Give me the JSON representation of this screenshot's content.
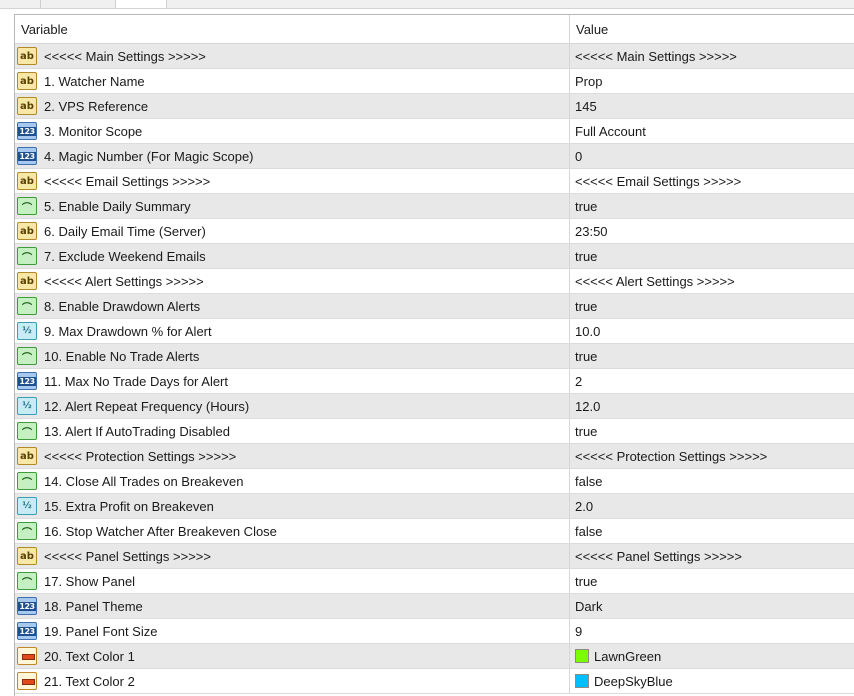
{
  "columns": {
    "variable": "Variable",
    "value": "Value"
  },
  "rows": [
    {
      "type": "string",
      "icon": "string-type-icon",
      "label": "<<<<< Main Settings >>>>>",
      "value": "<<<<< Main Settings >>>>>"
    },
    {
      "type": "string",
      "icon": "string-type-icon",
      "label": "1. Watcher Name",
      "value": "Prop"
    },
    {
      "type": "string",
      "icon": "string-type-icon",
      "label": "2. VPS Reference",
      "value": "145"
    },
    {
      "type": "integer",
      "icon": "integer-type-icon",
      "label": "3. Monitor Scope",
      "value": "Full Account"
    },
    {
      "type": "integer",
      "icon": "integer-type-icon",
      "label": "4. Magic Number (For Magic Scope)",
      "value": "0"
    },
    {
      "type": "string",
      "icon": "string-type-icon",
      "label": "<<<<< Email Settings >>>>>",
      "value": "<<<<< Email Settings >>>>>"
    },
    {
      "type": "bool",
      "icon": "bool-type-icon",
      "label": "5. Enable Daily Summary",
      "value": "true"
    },
    {
      "type": "string",
      "icon": "string-type-icon",
      "label": "6. Daily Email Time (Server)",
      "value": "23:50"
    },
    {
      "type": "bool",
      "icon": "bool-type-icon",
      "label": "7. Exclude Weekend Emails",
      "value": "true"
    },
    {
      "type": "string",
      "icon": "string-type-icon",
      "label": "<<<<< Alert Settings >>>>>",
      "value": "<<<<< Alert Settings >>>>>"
    },
    {
      "type": "bool",
      "icon": "bool-type-icon",
      "label": "8. Enable Drawdown Alerts",
      "value": "true"
    },
    {
      "type": "double",
      "icon": "double-type-icon",
      "label": "9. Max Drawdown % for Alert",
      "value": "10.0"
    },
    {
      "type": "bool",
      "icon": "bool-type-icon",
      "label": "10. Enable No Trade Alerts",
      "value": "true"
    },
    {
      "type": "integer",
      "icon": "integer-type-icon",
      "label": "11. Max No Trade Days for Alert",
      "value": "2"
    },
    {
      "type": "double",
      "icon": "double-type-icon",
      "label": "12. Alert Repeat Frequency (Hours)",
      "value": "12.0"
    },
    {
      "type": "bool",
      "icon": "bool-type-icon",
      "label": "13. Alert If AutoTrading Disabled",
      "value": "true"
    },
    {
      "type": "string",
      "icon": "string-type-icon",
      "label": "<<<<< Protection Settings >>>>>",
      "value": "<<<<< Protection Settings >>>>>"
    },
    {
      "type": "bool",
      "icon": "bool-type-icon",
      "label": "14. Close All Trades on Breakeven",
      "value": "false"
    },
    {
      "type": "double",
      "icon": "double-type-icon",
      "label": "15. Extra Profit on Breakeven",
      "value": "2.0"
    },
    {
      "type": "bool",
      "icon": "bool-type-icon",
      "label": "16. Stop Watcher After Breakeven Close",
      "value": "false"
    },
    {
      "type": "string",
      "icon": "string-type-icon",
      "label": "<<<<< Panel Settings >>>>>",
      "value": "<<<<< Panel Settings >>>>>"
    },
    {
      "type": "bool",
      "icon": "bool-type-icon",
      "label": "17. Show Panel",
      "value": "true"
    },
    {
      "type": "integer",
      "icon": "integer-type-icon",
      "label": "18. Panel Theme",
      "value": "Dark"
    },
    {
      "type": "integer",
      "icon": "integer-type-icon",
      "label": "19. Panel Font Size",
      "value": "9"
    },
    {
      "type": "color",
      "icon": "color-type-icon",
      "label": "20. Text Color 1",
      "value": "LawnGreen",
      "swatch": "#7CFC00"
    },
    {
      "type": "color",
      "icon": "color-type-icon",
      "label": "21. Text Color 2",
      "value": "DeepSkyBlue",
      "swatch": "#00BFFF"
    }
  ]
}
